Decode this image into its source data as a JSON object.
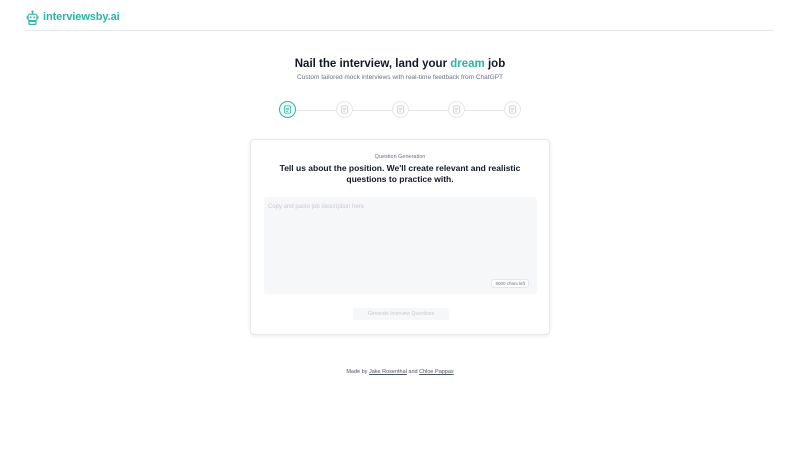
{
  "header": {
    "logo_text": "interviewsby.ai",
    "logo_icon": "robot-icon",
    "accent_color": "#2bb5a3"
  },
  "hero": {
    "title_before": "Nail the interview, land your ",
    "title_accent": "dream",
    "title_after": " job",
    "subtitle": "Custom tailored mock interviews with real-time feedback from ChatGPT"
  },
  "stepper": {
    "steps": [
      {
        "icon": "document-icon",
        "active": true
      },
      {
        "icon": "document-icon",
        "active": false
      },
      {
        "icon": "document-icon",
        "active": false
      },
      {
        "icon": "document-icon",
        "active": false
      },
      {
        "icon": "document-icon",
        "active": false
      }
    ]
  },
  "card": {
    "kicker": "Question Generation",
    "title": "Tell us about the position. We'll create relevant and realistic questions to practice with.",
    "textarea_placeholder": "Copy and paste job description here",
    "chars_left": "5000 chars left",
    "generate_button_label": "Generate Interview Questions"
  },
  "footer": {
    "made_by": "Made by",
    "author1": "Jake Rosenthal",
    "and": "and",
    "author2": "Chloe Pappas"
  }
}
